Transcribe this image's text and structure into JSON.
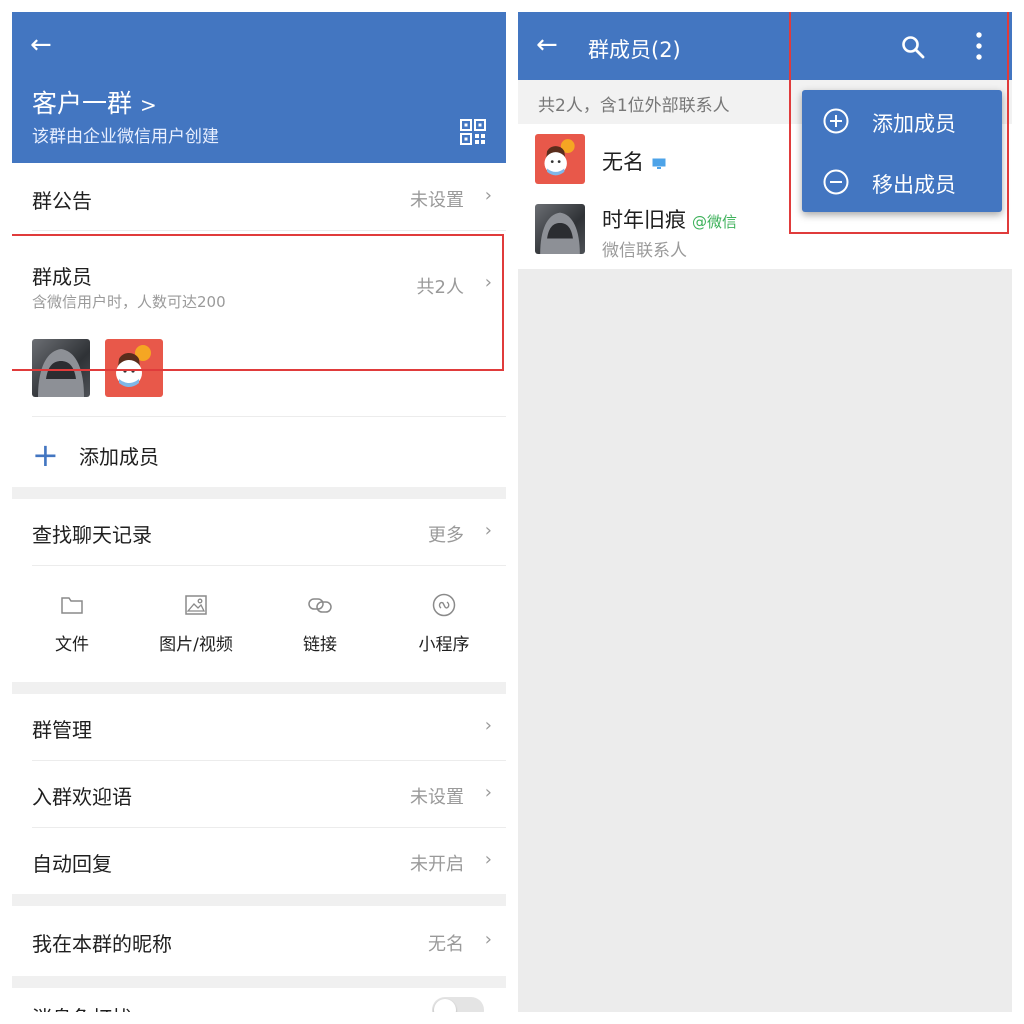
{
  "colors": {
    "header_blue": "#4376c1",
    "highlight_red": "#e03b3b",
    "wechat_green": "#3db15a",
    "secondary_text": "#9a9a9a"
  },
  "group_info": {
    "back_icon": "back-arrow-icon",
    "group_name": "客户一群",
    "name_chevron": ">",
    "subtitle": "该群由企业微信用户创建",
    "qr_icon": "qr-code-icon",
    "announcement": {
      "label": "群公告",
      "value": "未设置"
    },
    "members": {
      "label": "群成员",
      "hint": "含微信用户时，人数可达200",
      "count": "共2人"
    },
    "add_member": {
      "label": "添加成员",
      "icon": "plus-icon"
    },
    "search_history": {
      "label": "查找聊天记录",
      "value": "更多"
    },
    "quick_filters": [
      {
        "label": "文件",
        "icon": "folder-icon"
      },
      {
        "label": "图片/视频",
        "icon": "image-icon"
      },
      {
        "label": "链接",
        "icon": "link-icon"
      },
      {
        "label": "小程序",
        "icon": "mini-program-icon"
      }
    ],
    "group_manage": {
      "label": "群管理"
    },
    "welcome": {
      "label": "入群欢迎语",
      "value": "未设置"
    },
    "auto_reply": {
      "label": "自动回复",
      "value": "未开启"
    },
    "nickname": {
      "label": "我在本群的昵称",
      "value": "无名"
    },
    "dnd": {
      "label": "消息免打扰",
      "enabled": false
    }
  },
  "member_list": {
    "back_icon": "back-arrow-icon",
    "title": "群成员(2)",
    "search_icon": "search-icon",
    "more_icon": "more-vertical-icon",
    "count_text": "共2人，含1位外部联系人",
    "members": [
      {
        "name": "无名",
        "device_icon": "desktop-icon"
      },
      {
        "name": "时年旧痕",
        "tag": "@微信",
        "sub": "微信联系人"
      }
    ],
    "menu": [
      {
        "label": "添加成员",
        "icon": "plus-circle-icon"
      },
      {
        "label": "移出成员",
        "icon": "minus-circle-icon"
      }
    ]
  }
}
